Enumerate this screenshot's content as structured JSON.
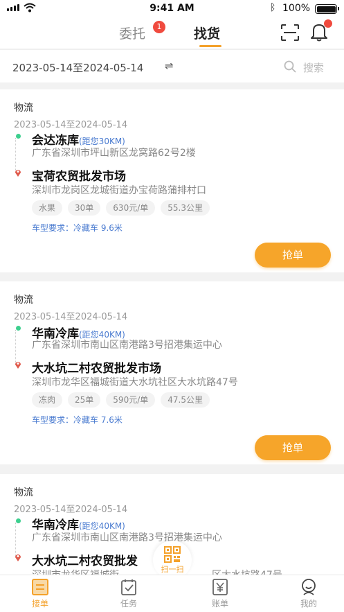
{
  "status_bar": {
    "time": "9:41 AM",
    "battery": "100%"
  },
  "nav": {
    "tab_entrust": "委托",
    "entrust_badge": "1",
    "tab_find": "找货"
  },
  "filter": {
    "date_range": "2023-05-14至2024-05-14",
    "swap_symbol": "⇌",
    "search_placeholder": "搜索"
  },
  "cards": [
    {
      "category": "物流",
      "date_range": "2023-05-14至2024-05-14",
      "origin_name": "会达冻库",
      "origin_distance": "(距您30KM)",
      "origin_address": "广东省深圳市坪山新区龙窝路62号2楼",
      "dest_name": "宝荷农贸批发市场",
      "dest_address": "深圳市龙岗区龙城街道办宝荷路蒲排村口",
      "tags": [
        "水果",
        "30单",
        "630元/单",
        "55.3公里"
      ],
      "requirement": "车型要求：冷藏车  9.6米",
      "button": "抢单"
    },
    {
      "category": "物流",
      "date_range": "2023-05-14至2024-05-14",
      "origin_name": "华南冷库",
      "origin_distance": "(距您40KM)",
      "origin_address": "广东省深圳市南山区南港路3号招港集运中心",
      "dest_name": "大水坑二村农贸批发市场",
      "dest_address": "深圳市龙华区福城街道大水坑社区大水坑路47号",
      "tags": [
        "冻肉",
        "25单",
        "590元/单",
        "47.5公里"
      ],
      "requirement": "车型要求：冷藏车 7.6米",
      "button": "抢单"
    },
    {
      "category": "物流",
      "date_range": "2023-05-14至2024-05-14",
      "origin_name": "华南冷库",
      "origin_distance": "(距您40KM)",
      "origin_address": "广东省深圳市南山区南港路3号招港集运中心",
      "dest_name": "大水坑二村农贸批发",
      "dest_address": "深圳市龙华区福城街",
      "dest_address_tail": "区大水坑路47号"
    }
  ],
  "tabbar": {
    "orders": "接单",
    "tasks": "任务",
    "scan": "扫一扫",
    "bills": "账单",
    "mine": "我的"
  },
  "colors": {
    "accent": "#f4a12a",
    "badge": "#f04a3e",
    "link": "#4a7bd0",
    "origin_dot": "#3ccf8e"
  }
}
